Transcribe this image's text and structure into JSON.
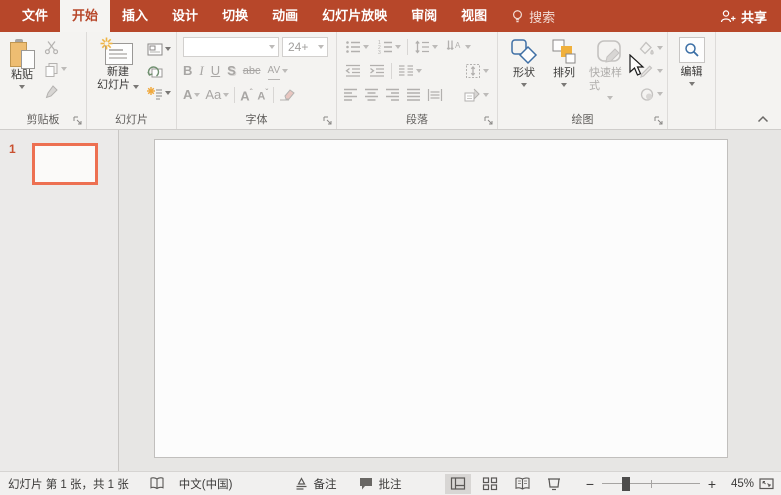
{
  "colors": {
    "titlebar_red": "#B7472A",
    "accent_orange": "#F0B03C",
    "thumb_border": "#ED7052",
    "shapes_blue": "#3F6FA5"
  },
  "titlebar": {
    "tabs": [
      {
        "label": "文件"
      },
      {
        "label": "开始"
      },
      {
        "label": "插入"
      },
      {
        "label": "设计"
      },
      {
        "label": "切换"
      },
      {
        "label": "动画"
      },
      {
        "label": "幻灯片放映"
      },
      {
        "label": "审阅"
      },
      {
        "label": "视图"
      }
    ],
    "search_label": "搜索",
    "share_label": "共享"
  },
  "ribbon": {
    "clipboard": {
      "label": "剪贴板",
      "paste": "粘贴"
    },
    "slides": {
      "label": "幻灯片",
      "new_slide_line1": "新建",
      "new_slide_line2": "幻灯片"
    },
    "font": {
      "label": "字体",
      "name_value": "",
      "size_value": "24+",
      "bold": "B",
      "italic": "I",
      "underline": "U",
      "shadow": "S",
      "strikethrough": "abc",
      "char_spacing": "AV",
      "font_color": "A",
      "change_case": "Aa",
      "grow_font": "A",
      "shrink_font": "A"
    },
    "paragraph": {
      "label": "段落"
    },
    "drawing": {
      "label": "绘图",
      "shapes": "形状",
      "arrange": "排列",
      "quick_styles": "快速样式"
    },
    "editing": {
      "label": "编辑"
    }
  },
  "slide_panel": {
    "slide_number": "1"
  },
  "statusbar": {
    "slide_info": "幻灯片 第 1 张，共 1 张",
    "language": "中文(中国)",
    "notes": "备注",
    "comments": "批注",
    "zoom_out": "−",
    "zoom_in": "+",
    "zoom_level": "45%"
  }
}
